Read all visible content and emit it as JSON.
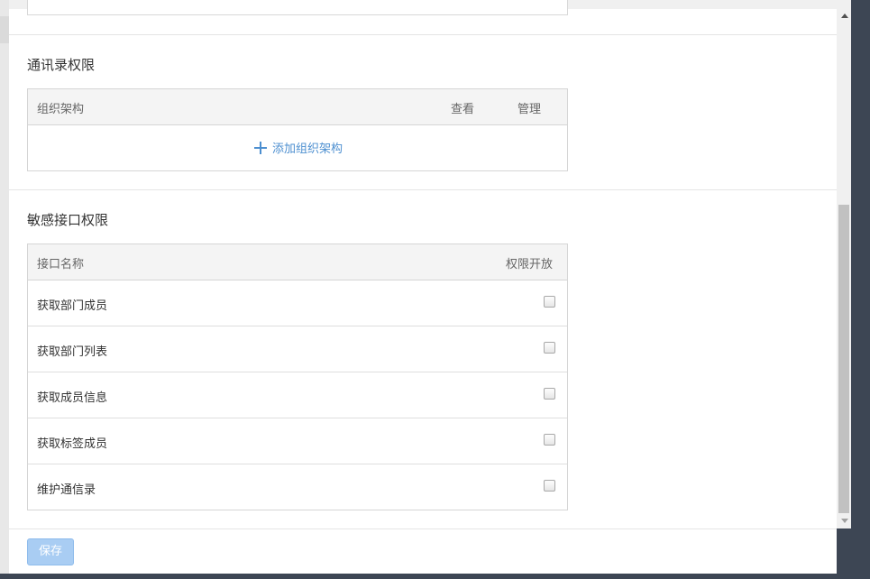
{
  "contacts_section": {
    "title": "通讯录权限",
    "columns": {
      "org": "组织架构",
      "view": "查看",
      "manage": "管理"
    },
    "add_label": "添加组织架构"
  },
  "api_section": {
    "title": "敏感接口权限",
    "columns": {
      "name": "接口名称",
      "enabled": "权限开放"
    },
    "rows": [
      {
        "name": "获取部门成员",
        "checked": false
      },
      {
        "name": "获取部门列表",
        "checked": false
      },
      {
        "name": "获取成员信息",
        "checked": false
      },
      {
        "name": "获取标签成员",
        "checked": false
      },
      {
        "name": "维护通信录",
        "checked": false
      }
    ]
  },
  "footer": {
    "save_label": "保存"
  },
  "icons": {
    "add": "plus-icon",
    "scroll_up": "scroll-up-arrow-icon",
    "scroll_down": "scroll-down-arrow-icon"
  },
  "colors": {
    "link": "#4d8fd0",
    "save_disabled": "#a9cdf3",
    "overlay": "#3d4654"
  }
}
